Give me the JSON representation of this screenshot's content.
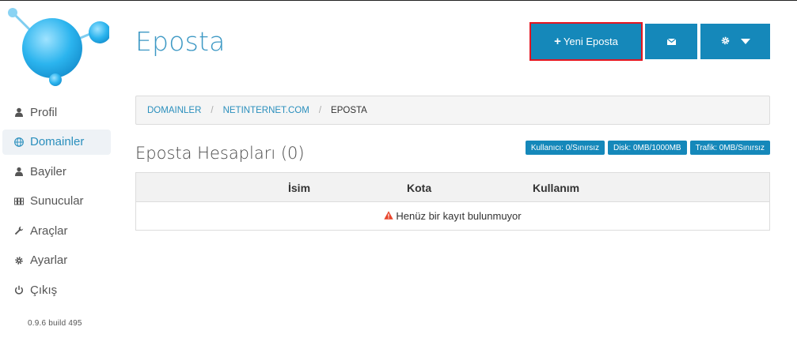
{
  "sidebar": {
    "items": [
      {
        "label": "Profil",
        "icon": "user-icon",
        "active": false
      },
      {
        "label": "Domainler",
        "icon": "globe-icon",
        "active": true
      },
      {
        "label": "Bayiler",
        "icon": "users-icon",
        "active": false
      },
      {
        "label": "Sunucular",
        "icon": "server-icon",
        "active": false
      },
      {
        "label": "Araçlar",
        "icon": "wrench-icon",
        "active": false
      },
      {
        "label": "Ayarlar",
        "icon": "gear-icon",
        "active": false
      },
      {
        "label": "Çıkış",
        "icon": "power-icon",
        "active": false
      }
    ],
    "version": "0.9.6 build 495"
  },
  "header": {
    "title": "Eposta",
    "new_button_label": "Yeni Eposta"
  },
  "breadcrumb": {
    "items": [
      "DOMAINLER",
      "NETINTERNET.COM"
    ],
    "current": "EPOSTA"
  },
  "section": {
    "title": "Eposta Hesapları (0)",
    "badges": [
      "Kullanıcı: 0/Sınırsız",
      "Disk: 0MB/1000MB",
      "Trafik: 0MB/Sınırsız"
    ]
  },
  "table": {
    "columns": [
      "İsim",
      "Kota",
      "Kullanım"
    ],
    "empty_message": "Henüz bir kayıt bulunmuyor"
  },
  "colors": {
    "accent": "#1588ba",
    "highlight_border": "#e4151f",
    "warning": "#e8452c"
  }
}
